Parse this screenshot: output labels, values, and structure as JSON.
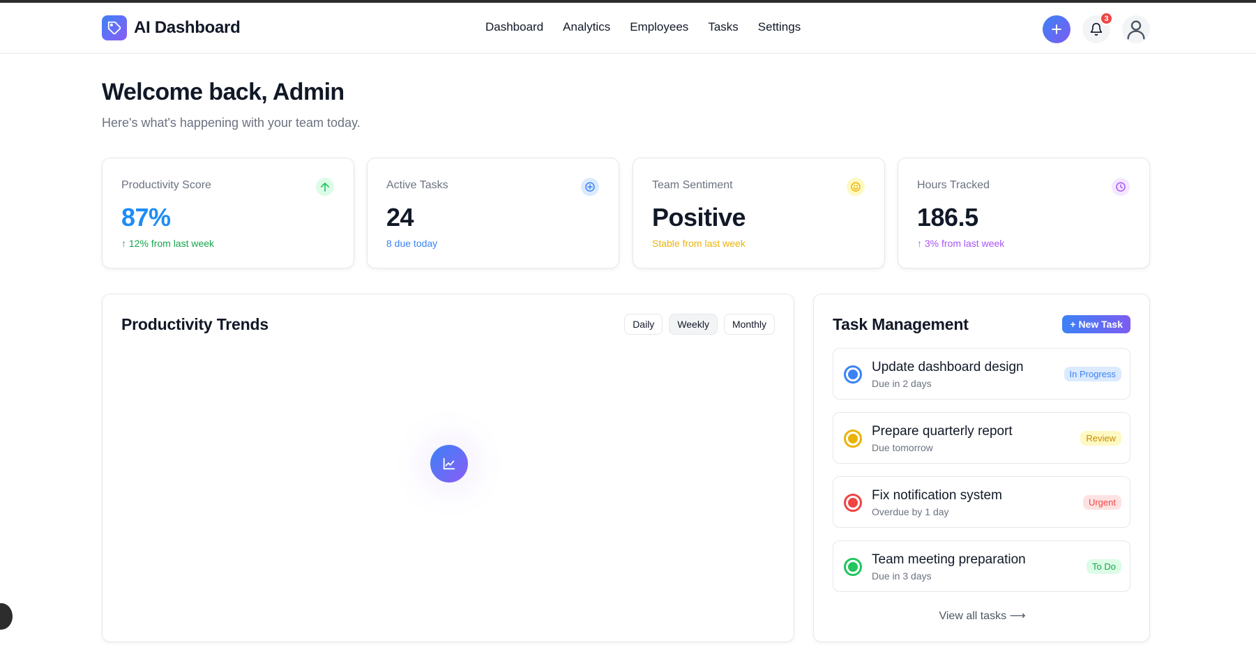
{
  "app": {
    "title": "AI Dashboard",
    "brand_color": "#3b82f6",
    "accent_color": "#8b5cf6"
  },
  "nav": {
    "items": [
      "Dashboard",
      "Analytics",
      "Employees",
      "Tasks",
      "Settings"
    ]
  },
  "header": {
    "notification_count": "3",
    "add_icon": "plus-icon",
    "bell_icon": "bell-icon",
    "avatar_icon": "user-icon"
  },
  "welcome": {
    "title": "Welcome back, Admin",
    "subtitle": "Here's what's happening with your team today."
  },
  "stats": [
    {
      "label": "Productivity Score",
      "value": "87%",
      "sub": "↑ 12% from last week",
      "icon": "arrow-up-icon",
      "color": "#1d8cf8",
      "sub_color": "#16a34a",
      "icon_bg": "#dcfce7"
    },
    {
      "label": "Active Tasks",
      "value": "24",
      "sub": "8 due today",
      "icon": "plus-circle-icon",
      "color": "#111827",
      "sub_color": "#3b82f6",
      "icon_bg": "#dbeafe"
    },
    {
      "label": "Team Sentiment",
      "value": "Positive",
      "sub": "Stable from last week",
      "icon": "smile-icon",
      "color": "#111827",
      "sub_color": "#eab308",
      "icon_bg": "#fef9c3"
    },
    {
      "label": "Hours Tracked",
      "value": "186.5",
      "sub": "↑ 3% from last week",
      "icon": "clock-icon",
      "color": "#111827",
      "sub_color": "#a855f7",
      "icon_bg": "#f3e8ff"
    }
  ],
  "trends": {
    "title": "Productivity Trends",
    "periods": [
      "Daily",
      "Weekly",
      "Monthly"
    ],
    "active_period": "Weekly",
    "placeholder_icon": "chart-icon"
  },
  "tasks": {
    "title": "Task Management",
    "new_task_label": "+ New Task",
    "items": [
      {
        "title": "Update dashboard design",
        "due": "Due in 2 days",
        "status": "In Progress",
        "color": "#3b82f6",
        "pill_bg": "#dbeafe",
        "pill_fg": "#3b82f6"
      },
      {
        "title": "Prepare quarterly report",
        "due": "Due tomorrow",
        "status": "Review",
        "color": "#eab308",
        "pill_bg": "#fef9c3",
        "pill_fg": "#ca8a04"
      },
      {
        "title": "Fix notification system",
        "due": "Overdue by 1 day",
        "status": "Urgent",
        "color": "#ef4444",
        "pill_bg": "#fee2e2",
        "pill_fg": "#ef4444"
      },
      {
        "title": "Team meeting preparation",
        "due": "Due in 3 days",
        "status": "To Do",
        "color": "#22c55e",
        "pill_bg": "#dcfce7",
        "pill_fg": "#16a34a"
      }
    ],
    "view_all_label": "View all tasks ⟶"
  }
}
